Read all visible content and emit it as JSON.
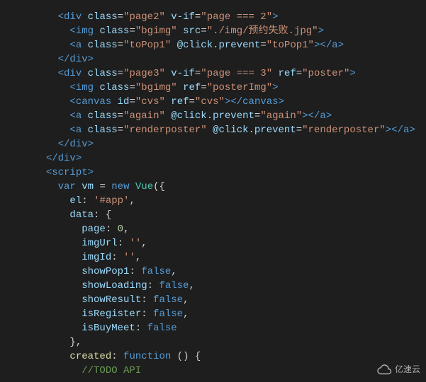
{
  "code": {
    "lines": [
      {
        "indent": 2,
        "tokens": [
          {
            "c": "tag",
            "t": "<"
          },
          {
            "c": "name",
            "t": "div"
          },
          {
            "c": "punct",
            "t": " "
          },
          {
            "c": "attr",
            "t": "class"
          },
          {
            "c": "punct",
            "t": "="
          },
          {
            "c": "str",
            "t": "\"page2\""
          },
          {
            "c": "punct",
            "t": " "
          },
          {
            "c": "attr",
            "t": "v-if"
          },
          {
            "c": "punct",
            "t": "="
          },
          {
            "c": "str",
            "t": "\"page === 2\""
          },
          {
            "c": "tag",
            "t": ">"
          }
        ]
      },
      {
        "indent": 3,
        "tokens": [
          {
            "c": "tag",
            "t": "<"
          },
          {
            "c": "name",
            "t": "img"
          },
          {
            "c": "punct",
            "t": " "
          },
          {
            "c": "attr",
            "t": "class"
          },
          {
            "c": "punct",
            "t": "="
          },
          {
            "c": "str",
            "t": "\"bgimg\""
          },
          {
            "c": "punct",
            "t": " "
          },
          {
            "c": "attr",
            "t": "src"
          },
          {
            "c": "punct",
            "t": "="
          },
          {
            "c": "str",
            "t": "\"./img/预约失败.jpg\""
          },
          {
            "c": "tag",
            "t": ">"
          }
        ]
      },
      {
        "indent": 3,
        "tokens": [
          {
            "c": "tag",
            "t": "<"
          },
          {
            "c": "name",
            "t": "a"
          },
          {
            "c": "punct",
            "t": " "
          },
          {
            "c": "attr",
            "t": "class"
          },
          {
            "c": "punct",
            "t": "="
          },
          {
            "c": "str",
            "t": "\"toPop1\""
          },
          {
            "c": "punct",
            "t": " "
          },
          {
            "c": "attr",
            "t": "@click.prevent"
          },
          {
            "c": "punct",
            "t": "="
          },
          {
            "c": "str",
            "t": "\"toPop1\""
          },
          {
            "c": "tag",
            "t": ">"
          },
          {
            "c": "tag",
            "t": "</"
          },
          {
            "c": "name",
            "t": "a"
          },
          {
            "c": "tag",
            "t": ">"
          }
        ]
      },
      {
        "indent": 2,
        "tokens": [
          {
            "c": "tag",
            "t": "</"
          },
          {
            "c": "name",
            "t": "div"
          },
          {
            "c": "tag",
            "t": ">"
          }
        ]
      },
      {
        "indent": 2,
        "tokens": [
          {
            "c": "tag",
            "t": "<"
          },
          {
            "c": "name",
            "t": "div"
          },
          {
            "c": "punct",
            "t": " "
          },
          {
            "c": "attr",
            "t": "class"
          },
          {
            "c": "punct",
            "t": "="
          },
          {
            "c": "str",
            "t": "\"page3\""
          },
          {
            "c": "punct",
            "t": " "
          },
          {
            "c": "attr",
            "t": "v-if"
          },
          {
            "c": "punct",
            "t": "="
          },
          {
            "c": "str",
            "t": "\"page === 3\""
          },
          {
            "c": "punct",
            "t": " "
          },
          {
            "c": "attr",
            "t": "ref"
          },
          {
            "c": "punct",
            "t": "="
          },
          {
            "c": "str",
            "t": "\"poster\""
          },
          {
            "c": "tag",
            "t": ">"
          }
        ]
      },
      {
        "indent": 3,
        "tokens": [
          {
            "c": "tag",
            "t": "<"
          },
          {
            "c": "name",
            "t": "img"
          },
          {
            "c": "punct",
            "t": " "
          },
          {
            "c": "attr",
            "t": "class"
          },
          {
            "c": "punct",
            "t": "="
          },
          {
            "c": "str",
            "t": "\"bgimg\""
          },
          {
            "c": "punct",
            "t": " "
          },
          {
            "c": "attr",
            "t": "ref"
          },
          {
            "c": "punct",
            "t": "="
          },
          {
            "c": "str",
            "t": "\"posterImg\""
          },
          {
            "c": "tag",
            "t": ">"
          }
        ]
      },
      {
        "indent": 3,
        "tokens": [
          {
            "c": "tag",
            "t": "<"
          },
          {
            "c": "name",
            "t": "canvas"
          },
          {
            "c": "punct",
            "t": " "
          },
          {
            "c": "attr",
            "t": "id"
          },
          {
            "c": "punct",
            "t": "="
          },
          {
            "c": "str",
            "t": "\"cvs\""
          },
          {
            "c": "punct",
            "t": " "
          },
          {
            "c": "attr",
            "t": "ref"
          },
          {
            "c": "punct",
            "t": "="
          },
          {
            "c": "str",
            "t": "\"cvs\""
          },
          {
            "c": "tag",
            "t": ">"
          },
          {
            "c": "tag",
            "t": "</"
          },
          {
            "c": "name",
            "t": "canvas"
          },
          {
            "c": "tag",
            "t": ">"
          }
        ]
      },
      {
        "indent": 3,
        "tokens": [
          {
            "c": "tag",
            "t": "<"
          },
          {
            "c": "name",
            "t": "a"
          },
          {
            "c": "punct",
            "t": " "
          },
          {
            "c": "attr",
            "t": "class"
          },
          {
            "c": "punct",
            "t": "="
          },
          {
            "c": "str",
            "t": "\"again\""
          },
          {
            "c": "punct",
            "t": " "
          },
          {
            "c": "attr",
            "t": "@click.prevent"
          },
          {
            "c": "punct",
            "t": "="
          },
          {
            "c": "str",
            "t": "\"again\""
          },
          {
            "c": "tag",
            "t": ">"
          },
          {
            "c": "tag",
            "t": "</"
          },
          {
            "c": "name",
            "t": "a"
          },
          {
            "c": "tag",
            "t": ">"
          }
        ]
      },
      {
        "indent": 3,
        "tokens": [
          {
            "c": "tag",
            "t": "<"
          },
          {
            "c": "name",
            "t": "a"
          },
          {
            "c": "punct",
            "t": " "
          },
          {
            "c": "attr",
            "t": "class"
          },
          {
            "c": "punct",
            "t": "="
          },
          {
            "c": "str",
            "t": "\"renderposter\""
          },
          {
            "c": "punct",
            "t": " "
          },
          {
            "c": "attr",
            "t": "@click.prevent"
          },
          {
            "c": "punct",
            "t": "="
          },
          {
            "c": "str",
            "t": "\"renderposter\""
          },
          {
            "c": "tag",
            "t": ">"
          },
          {
            "c": "tag",
            "t": "</"
          },
          {
            "c": "name",
            "t": "a"
          },
          {
            "c": "tag",
            "t": ">"
          }
        ]
      },
      {
        "indent": 2,
        "tokens": [
          {
            "c": "tag",
            "t": "</"
          },
          {
            "c": "name",
            "t": "div"
          },
          {
            "c": "tag",
            "t": ">"
          }
        ]
      },
      {
        "indent": 1,
        "tokens": [
          {
            "c": "tag",
            "t": "</"
          },
          {
            "c": "name",
            "t": "div"
          },
          {
            "c": "tag",
            "t": ">"
          }
        ]
      },
      {
        "indent": 1,
        "tokens": [
          {
            "c": "tag",
            "t": "<"
          },
          {
            "c": "name",
            "t": "script"
          },
          {
            "c": "tag",
            "t": ">"
          }
        ]
      },
      {
        "indent": 2,
        "tokens": [
          {
            "c": "key",
            "t": "var"
          },
          {
            "c": "punct",
            "t": " "
          },
          {
            "c": "ident",
            "t": "vm"
          },
          {
            "c": "punct",
            "t": " "
          },
          {
            "c": "punct",
            "t": "="
          },
          {
            "c": "punct",
            "t": " "
          },
          {
            "c": "key",
            "t": "new"
          },
          {
            "c": "punct",
            "t": " "
          },
          {
            "c": "type",
            "t": "Vue"
          },
          {
            "c": "punct",
            "t": "({"
          }
        ]
      },
      {
        "indent": 3,
        "tokens": [
          {
            "c": "ident",
            "t": "el"
          },
          {
            "c": "punct",
            "t": ": "
          },
          {
            "c": "str",
            "t": "'#app'"
          },
          {
            "c": "punct",
            "t": ","
          }
        ]
      },
      {
        "indent": 3,
        "tokens": [
          {
            "c": "ident",
            "t": "data"
          },
          {
            "c": "punct",
            "t": ": {"
          }
        ]
      },
      {
        "indent": 4,
        "tokens": [
          {
            "c": "ident",
            "t": "page"
          },
          {
            "c": "punct",
            "t": ": "
          },
          {
            "c": "num",
            "t": "0"
          },
          {
            "c": "punct",
            "t": ","
          }
        ]
      },
      {
        "indent": 4,
        "tokens": [
          {
            "c": "ident",
            "t": "imgUrl"
          },
          {
            "c": "punct",
            "t": ": "
          },
          {
            "c": "str",
            "t": "''"
          },
          {
            "c": "punct",
            "t": ","
          }
        ]
      },
      {
        "indent": 4,
        "tokens": [
          {
            "c": "ident",
            "t": "imgId"
          },
          {
            "c": "punct",
            "t": ": "
          },
          {
            "c": "str",
            "t": "''"
          },
          {
            "c": "punct",
            "t": ","
          }
        ]
      },
      {
        "indent": 4,
        "tokens": [
          {
            "c": "ident",
            "t": "showPop1"
          },
          {
            "c": "punct",
            "t": ": "
          },
          {
            "c": "bool",
            "t": "false"
          },
          {
            "c": "punct",
            "t": ","
          }
        ]
      },
      {
        "indent": 4,
        "tokens": [
          {
            "c": "ident",
            "t": "showLoading"
          },
          {
            "c": "punct",
            "t": ": "
          },
          {
            "c": "bool",
            "t": "false"
          },
          {
            "c": "punct",
            "t": ","
          }
        ]
      },
      {
        "indent": 4,
        "tokens": [
          {
            "c": "ident",
            "t": "showResult"
          },
          {
            "c": "punct",
            "t": ": "
          },
          {
            "c": "bool",
            "t": "false"
          },
          {
            "c": "punct",
            "t": ","
          }
        ]
      },
      {
        "indent": 4,
        "tokens": [
          {
            "c": "ident",
            "t": "isRegister"
          },
          {
            "c": "punct",
            "t": ": "
          },
          {
            "c": "bool",
            "t": "false"
          },
          {
            "c": "punct",
            "t": ","
          }
        ]
      },
      {
        "indent": 4,
        "tokens": [
          {
            "c": "ident",
            "t": "isBuyMeet"
          },
          {
            "c": "punct",
            "t": ": "
          },
          {
            "c": "bool",
            "t": "false"
          }
        ]
      },
      {
        "indent": 3,
        "tokens": [
          {
            "c": "punct",
            "t": "},"
          }
        ]
      },
      {
        "indent": 3,
        "tokens": [
          {
            "c": "func",
            "t": "created"
          },
          {
            "c": "punct",
            "t": ": "
          },
          {
            "c": "funckw",
            "t": "function"
          },
          {
            "c": "punct",
            "t": " () {"
          }
        ]
      },
      {
        "indent": 4,
        "tokens": [
          {
            "c": "cmt",
            "t": "//TODO API"
          }
        ]
      }
    ]
  },
  "watermark": {
    "text": "亿速云"
  }
}
